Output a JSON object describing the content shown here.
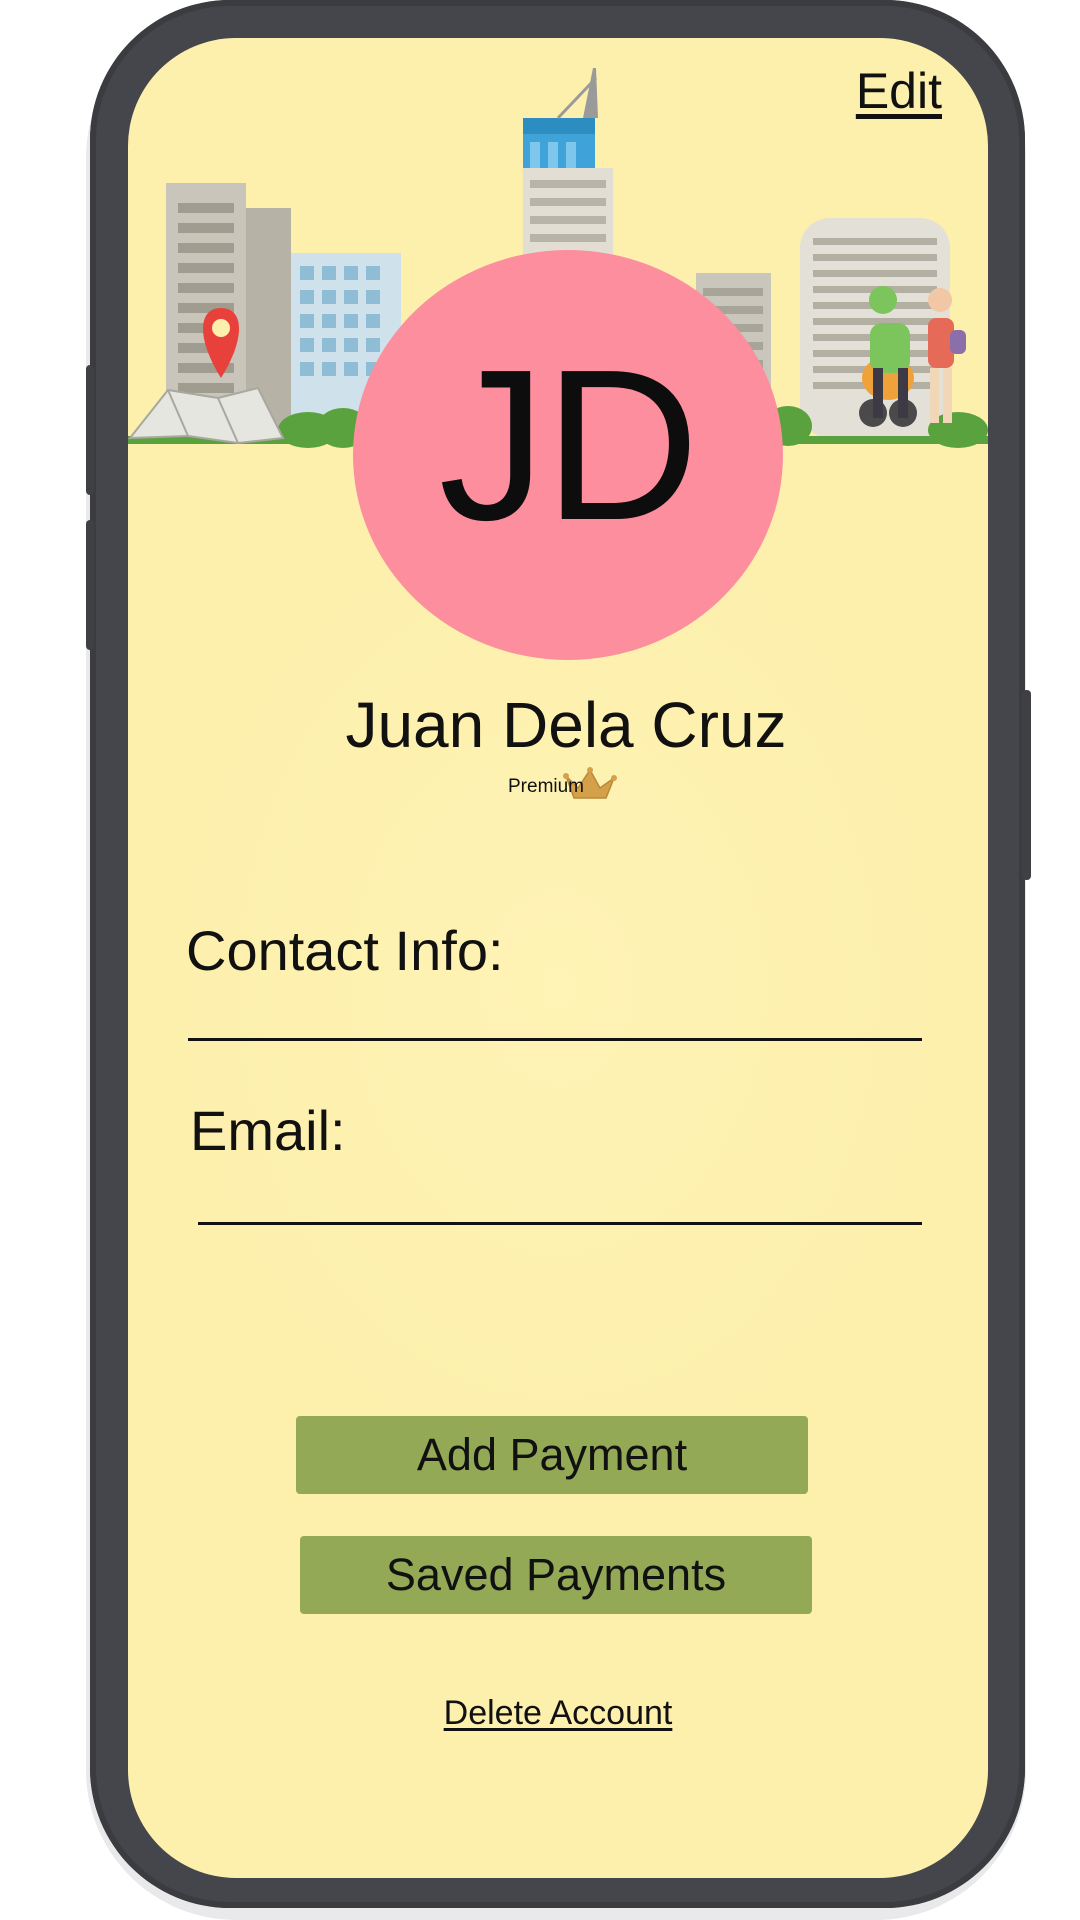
{
  "header": {
    "edit_label": "Edit"
  },
  "profile": {
    "initials": "JD",
    "name": "Juan Dela Cruz",
    "tier": "Premium",
    "avatar_color": "#fc8e9e"
  },
  "contact": {
    "contact_label": "Contact Info:",
    "contact_value": "",
    "email_label": "Email:",
    "email_value": ""
  },
  "actions": {
    "add_payment_label": "Add Payment",
    "saved_payments_label": "Saved Payments",
    "delete_account_label": "Delete Account",
    "button_color": "#93a955"
  },
  "theme": {
    "background": "#fdf0ad",
    "frame": "#45464b"
  },
  "icons": [
    "map-pin-icon",
    "crown-icon"
  ]
}
